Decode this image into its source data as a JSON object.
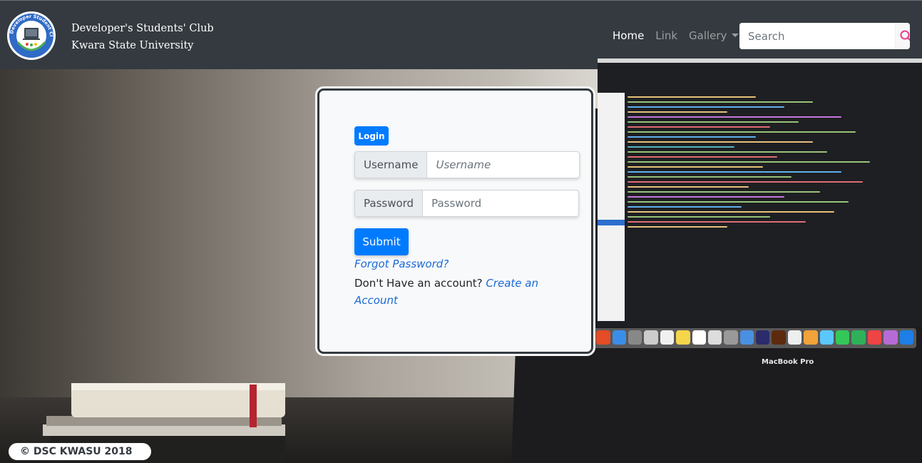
{
  "brand": {
    "line1": "Developer's Students' Club",
    "line2": "Kwara State University",
    "logo_text": "Developer Student Clubs"
  },
  "nav": {
    "items": [
      {
        "label": "Home",
        "active": true
      },
      {
        "label": "Link",
        "active": false
      },
      {
        "label": "Gallery",
        "active": false,
        "dropdown": true
      }
    ],
    "search": {
      "placeholder": "Search",
      "icon": "search-icon",
      "icon_color": "#e83e8c"
    }
  },
  "login": {
    "badge": "Login",
    "username_label": "Username",
    "username_placeholder": "Username",
    "password_label": "Password",
    "password_placeholder": "Password",
    "submit_label": "Submit",
    "forgot_label": "Forgot Password?",
    "no_account_text": "Don't Have an account?",
    "create_label": "Create an Account"
  },
  "laptop_label": "MacBook Pro",
  "footer": {
    "text": "© DSC KWASU 2018"
  },
  "colors": {
    "navbar": "#343a40",
    "primary": "#007bff",
    "link": "#1a6ad6",
    "card": "#f8f9fa"
  }
}
